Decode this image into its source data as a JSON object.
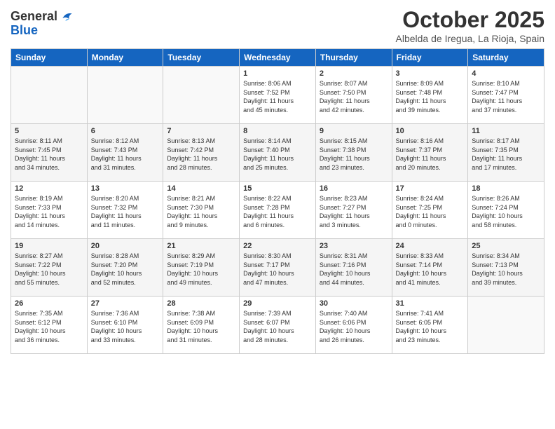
{
  "header": {
    "logo_line1": "General",
    "logo_line2": "Blue",
    "month": "October 2025",
    "location": "Albelda de Iregua, La Rioja, Spain"
  },
  "weekdays": [
    "Sunday",
    "Monday",
    "Tuesday",
    "Wednesday",
    "Thursday",
    "Friday",
    "Saturday"
  ],
  "weeks": [
    [
      {
        "day": "",
        "info": ""
      },
      {
        "day": "",
        "info": ""
      },
      {
        "day": "",
        "info": ""
      },
      {
        "day": "1",
        "info": "Sunrise: 8:06 AM\nSunset: 7:52 PM\nDaylight: 11 hours\nand 45 minutes."
      },
      {
        "day": "2",
        "info": "Sunrise: 8:07 AM\nSunset: 7:50 PM\nDaylight: 11 hours\nand 42 minutes."
      },
      {
        "day": "3",
        "info": "Sunrise: 8:09 AM\nSunset: 7:48 PM\nDaylight: 11 hours\nand 39 minutes."
      },
      {
        "day": "4",
        "info": "Sunrise: 8:10 AM\nSunset: 7:47 PM\nDaylight: 11 hours\nand 37 minutes."
      }
    ],
    [
      {
        "day": "5",
        "info": "Sunrise: 8:11 AM\nSunset: 7:45 PM\nDaylight: 11 hours\nand 34 minutes."
      },
      {
        "day": "6",
        "info": "Sunrise: 8:12 AM\nSunset: 7:43 PM\nDaylight: 11 hours\nand 31 minutes."
      },
      {
        "day": "7",
        "info": "Sunrise: 8:13 AM\nSunset: 7:42 PM\nDaylight: 11 hours\nand 28 minutes."
      },
      {
        "day": "8",
        "info": "Sunrise: 8:14 AM\nSunset: 7:40 PM\nDaylight: 11 hours\nand 25 minutes."
      },
      {
        "day": "9",
        "info": "Sunrise: 8:15 AM\nSunset: 7:38 PM\nDaylight: 11 hours\nand 23 minutes."
      },
      {
        "day": "10",
        "info": "Sunrise: 8:16 AM\nSunset: 7:37 PM\nDaylight: 11 hours\nand 20 minutes."
      },
      {
        "day": "11",
        "info": "Sunrise: 8:17 AM\nSunset: 7:35 PM\nDaylight: 11 hours\nand 17 minutes."
      }
    ],
    [
      {
        "day": "12",
        "info": "Sunrise: 8:19 AM\nSunset: 7:33 PM\nDaylight: 11 hours\nand 14 minutes."
      },
      {
        "day": "13",
        "info": "Sunrise: 8:20 AM\nSunset: 7:32 PM\nDaylight: 11 hours\nand 11 minutes."
      },
      {
        "day": "14",
        "info": "Sunrise: 8:21 AM\nSunset: 7:30 PM\nDaylight: 11 hours\nand 9 minutes."
      },
      {
        "day": "15",
        "info": "Sunrise: 8:22 AM\nSunset: 7:28 PM\nDaylight: 11 hours\nand 6 minutes."
      },
      {
        "day": "16",
        "info": "Sunrise: 8:23 AM\nSunset: 7:27 PM\nDaylight: 11 hours\nand 3 minutes."
      },
      {
        "day": "17",
        "info": "Sunrise: 8:24 AM\nSunset: 7:25 PM\nDaylight: 11 hours\nand 0 minutes."
      },
      {
        "day": "18",
        "info": "Sunrise: 8:26 AM\nSunset: 7:24 PM\nDaylight: 10 hours\nand 58 minutes."
      }
    ],
    [
      {
        "day": "19",
        "info": "Sunrise: 8:27 AM\nSunset: 7:22 PM\nDaylight: 10 hours\nand 55 minutes."
      },
      {
        "day": "20",
        "info": "Sunrise: 8:28 AM\nSunset: 7:20 PM\nDaylight: 10 hours\nand 52 minutes."
      },
      {
        "day": "21",
        "info": "Sunrise: 8:29 AM\nSunset: 7:19 PM\nDaylight: 10 hours\nand 49 minutes."
      },
      {
        "day": "22",
        "info": "Sunrise: 8:30 AM\nSunset: 7:17 PM\nDaylight: 10 hours\nand 47 minutes."
      },
      {
        "day": "23",
        "info": "Sunrise: 8:31 AM\nSunset: 7:16 PM\nDaylight: 10 hours\nand 44 minutes."
      },
      {
        "day": "24",
        "info": "Sunrise: 8:33 AM\nSunset: 7:14 PM\nDaylight: 10 hours\nand 41 minutes."
      },
      {
        "day": "25",
        "info": "Sunrise: 8:34 AM\nSunset: 7:13 PM\nDaylight: 10 hours\nand 39 minutes."
      }
    ],
    [
      {
        "day": "26",
        "info": "Sunrise: 7:35 AM\nSunset: 6:12 PM\nDaylight: 10 hours\nand 36 minutes."
      },
      {
        "day": "27",
        "info": "Sunrise: 7:36 AM\nSunset: 6:10 PM\nDaylight: 10 hours\nand 33 minutes."
      },
      {
        "day": "28",
        "info": "Sunrise: 7:38 AM\nSunset: 6:09 PM\nDaylight: 10 hours\nand 31 minutes."
      },
      {
        "day": "29",
        "info": "Sunrise: 7:39 AM\nSunset: 6:07 PM\nDaylight: 10 hours\nand 28 minutes."
      },
      {
        "day": "30",
        "info": "Sunrise: 7:40 AM\nSunset: 6:06 PM\nDaylight: 10 hours\nand 26 minutes."
      },
      {
        "day": "31",
        "info": "Sunrise: 7:41 AM\nSunset: 6:05 PM\nDaylight: 10 hours\nand 23 minutes."
      },
      {
        "day": "",
        "info": ""
      }
    ]
  ]
}
